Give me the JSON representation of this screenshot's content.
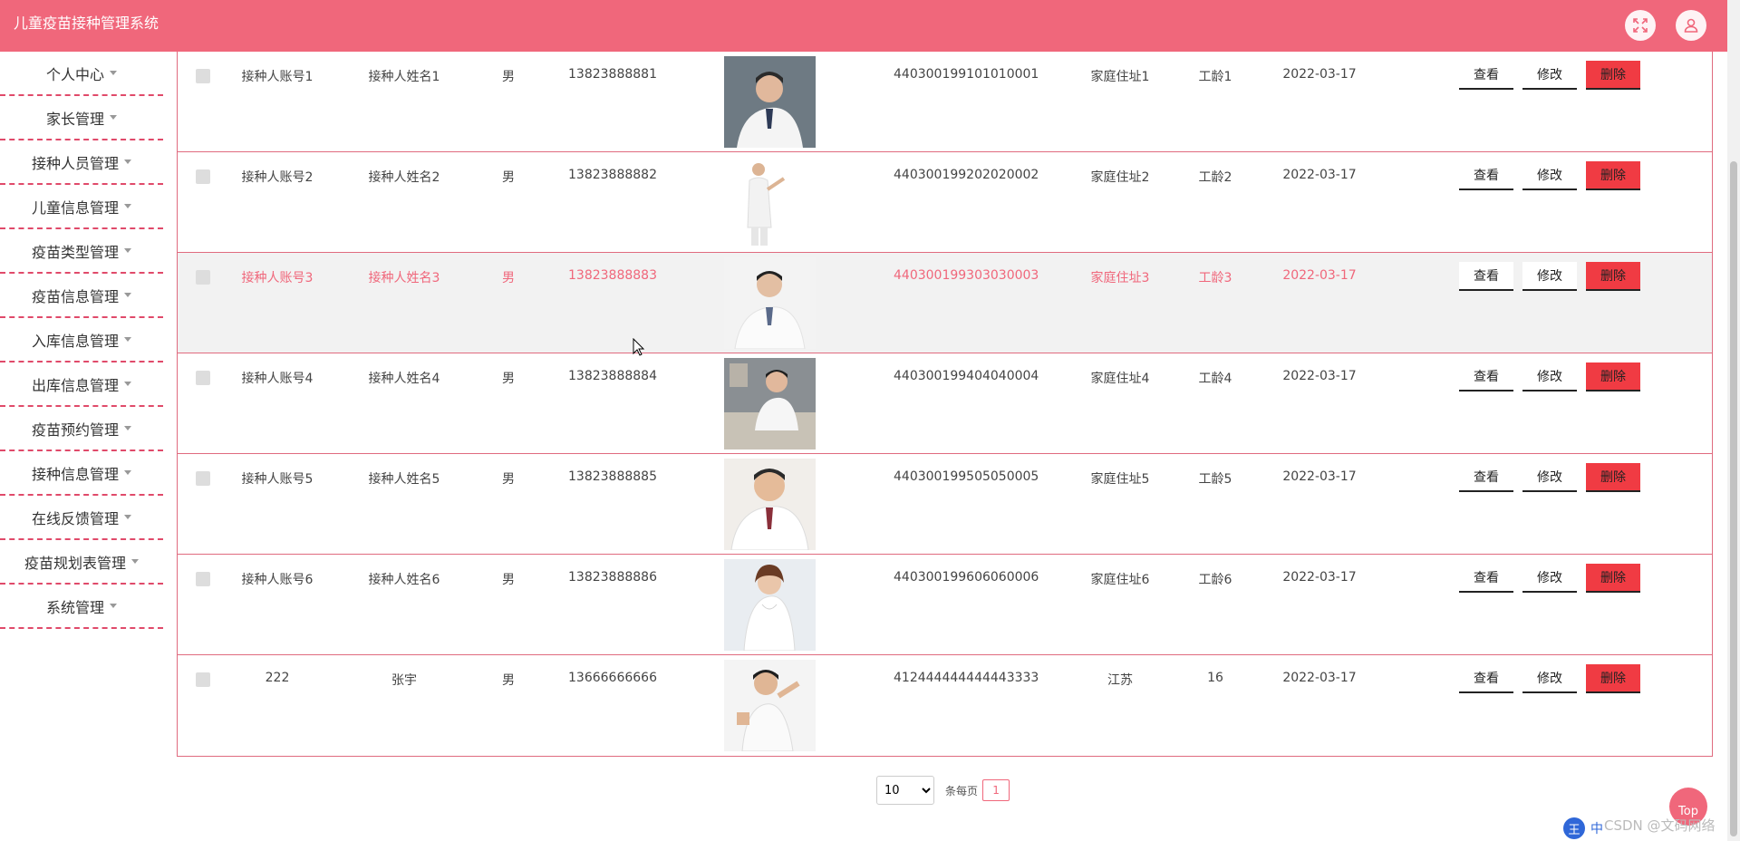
{
  "header": {
    "title": "儿童疫苗接种管理系统",
    "fullscreen_icon": "fullscreen-icon",
    "user_icon": "user-icon",
    "colors": {
      "brand": "#f0677b",
      "delete": "#f03b43"
    }
  },
  "sidebar": {
    "items": [
      {
        "label": "个人中心"
      },
      {
        "label": "家长管理"
      },
      {
        "label": "接种人员管理"
      },
      {
        "label": "儿童信息管理"
      },
      {
        "label": "疫苗类型管理"
      },
      {
        "label": "疫苗信息管理"
      },
      {
        "label": "入库信息管理"
      },
      {
        "label": "出库信息管理"
      },
      {
        "label": "疫苗预约管理"
      },
      {
        "label": "接种信息管理"
      },
      {
        "label": "在线反馈管理"
      },
      {
        "label": "疫苗规划表管理"
      },
      {
        "label": "系统管理"
      }
    ]
  },
  "table": {
    "rows": [
      {
        "account": "接种人账号1",
        "name": "接种人姓名1",
        "gender": "男",
        "phone": "13823888881",
        "id_number": "440300199101010001",
        "address": "家庭住址1",
        "seniority": "工龄1",
        "date": "2022-03-17"
      },
      {
        "account": "接种人账号2",
        "name": "接种人姓名2",
        "gender": "男",
        "phone": "13823888882",
        "id_number": "440300199202020002",
        "address": "家庭住址2",
        "seniority": "工龄2",
        "date": "2022-03-17"
      },
      {
        "account": "接种人账号3",
        "name": "接种人姓名3",
        "gender": "男",
        "phone": "13823888883",
        "id_number": "440300199303030003",
        "address": "家庭住址3",
        "seniority": "工龄3",
        "date": "2022-03-17"
      },
      {
        "account": "接种人账号4",
        "name": "接种人姓名4",
        "gender": "男",
        "phone": "13823888884",
        "id_number": "440300199404040004",
        "address": "家庭住址4",
        "seniority": "工龄4",
        "date": "2022-03-17"
      },
      {
        "account": "接种人账号5",
        "name": "接种人姓名5",
        "gender": "男",
        "phone": "13823888885",
        "id_number": "440300199505050005",
        "address": "家庭住址5",
        "seniority": "工龄5",
        "date": "2022-03-17"
      },
      {
        "account": "接种人账号6",
        "name": "接种人姓名6",
        "gender": "男",
        "phone": "13823888886",
        "id_number": "440300199606060006",
        "address": "家庭住址6",
        "seniority": "工龄6",
        "date": "2022-03-17"
      },
      {
        "account": "222",
        "name": "张宇",
        "gender": "男",
        "phone": "13666666666",
        "id_number": "412444444444443333",
        "address": "江苏",
        "seniority": "16",
        "date": "2022-03-17"
      }
    ],
    "actions": {
      "view": "查看",
      "edit": "修改",
      "delete": "删除"
    }
  },
  "pagination": {
    "page_size": "10",
    "page_size_options": [
      "10"
    ],
    "per_page_label": "条每页",
    "current_page": "1"
  },
  "back_to_top": "Top",
  "watermark": "CSDN @文码网络",
  "ime": {
    "logo": "王",
    "glyph": "中"
  }
}
